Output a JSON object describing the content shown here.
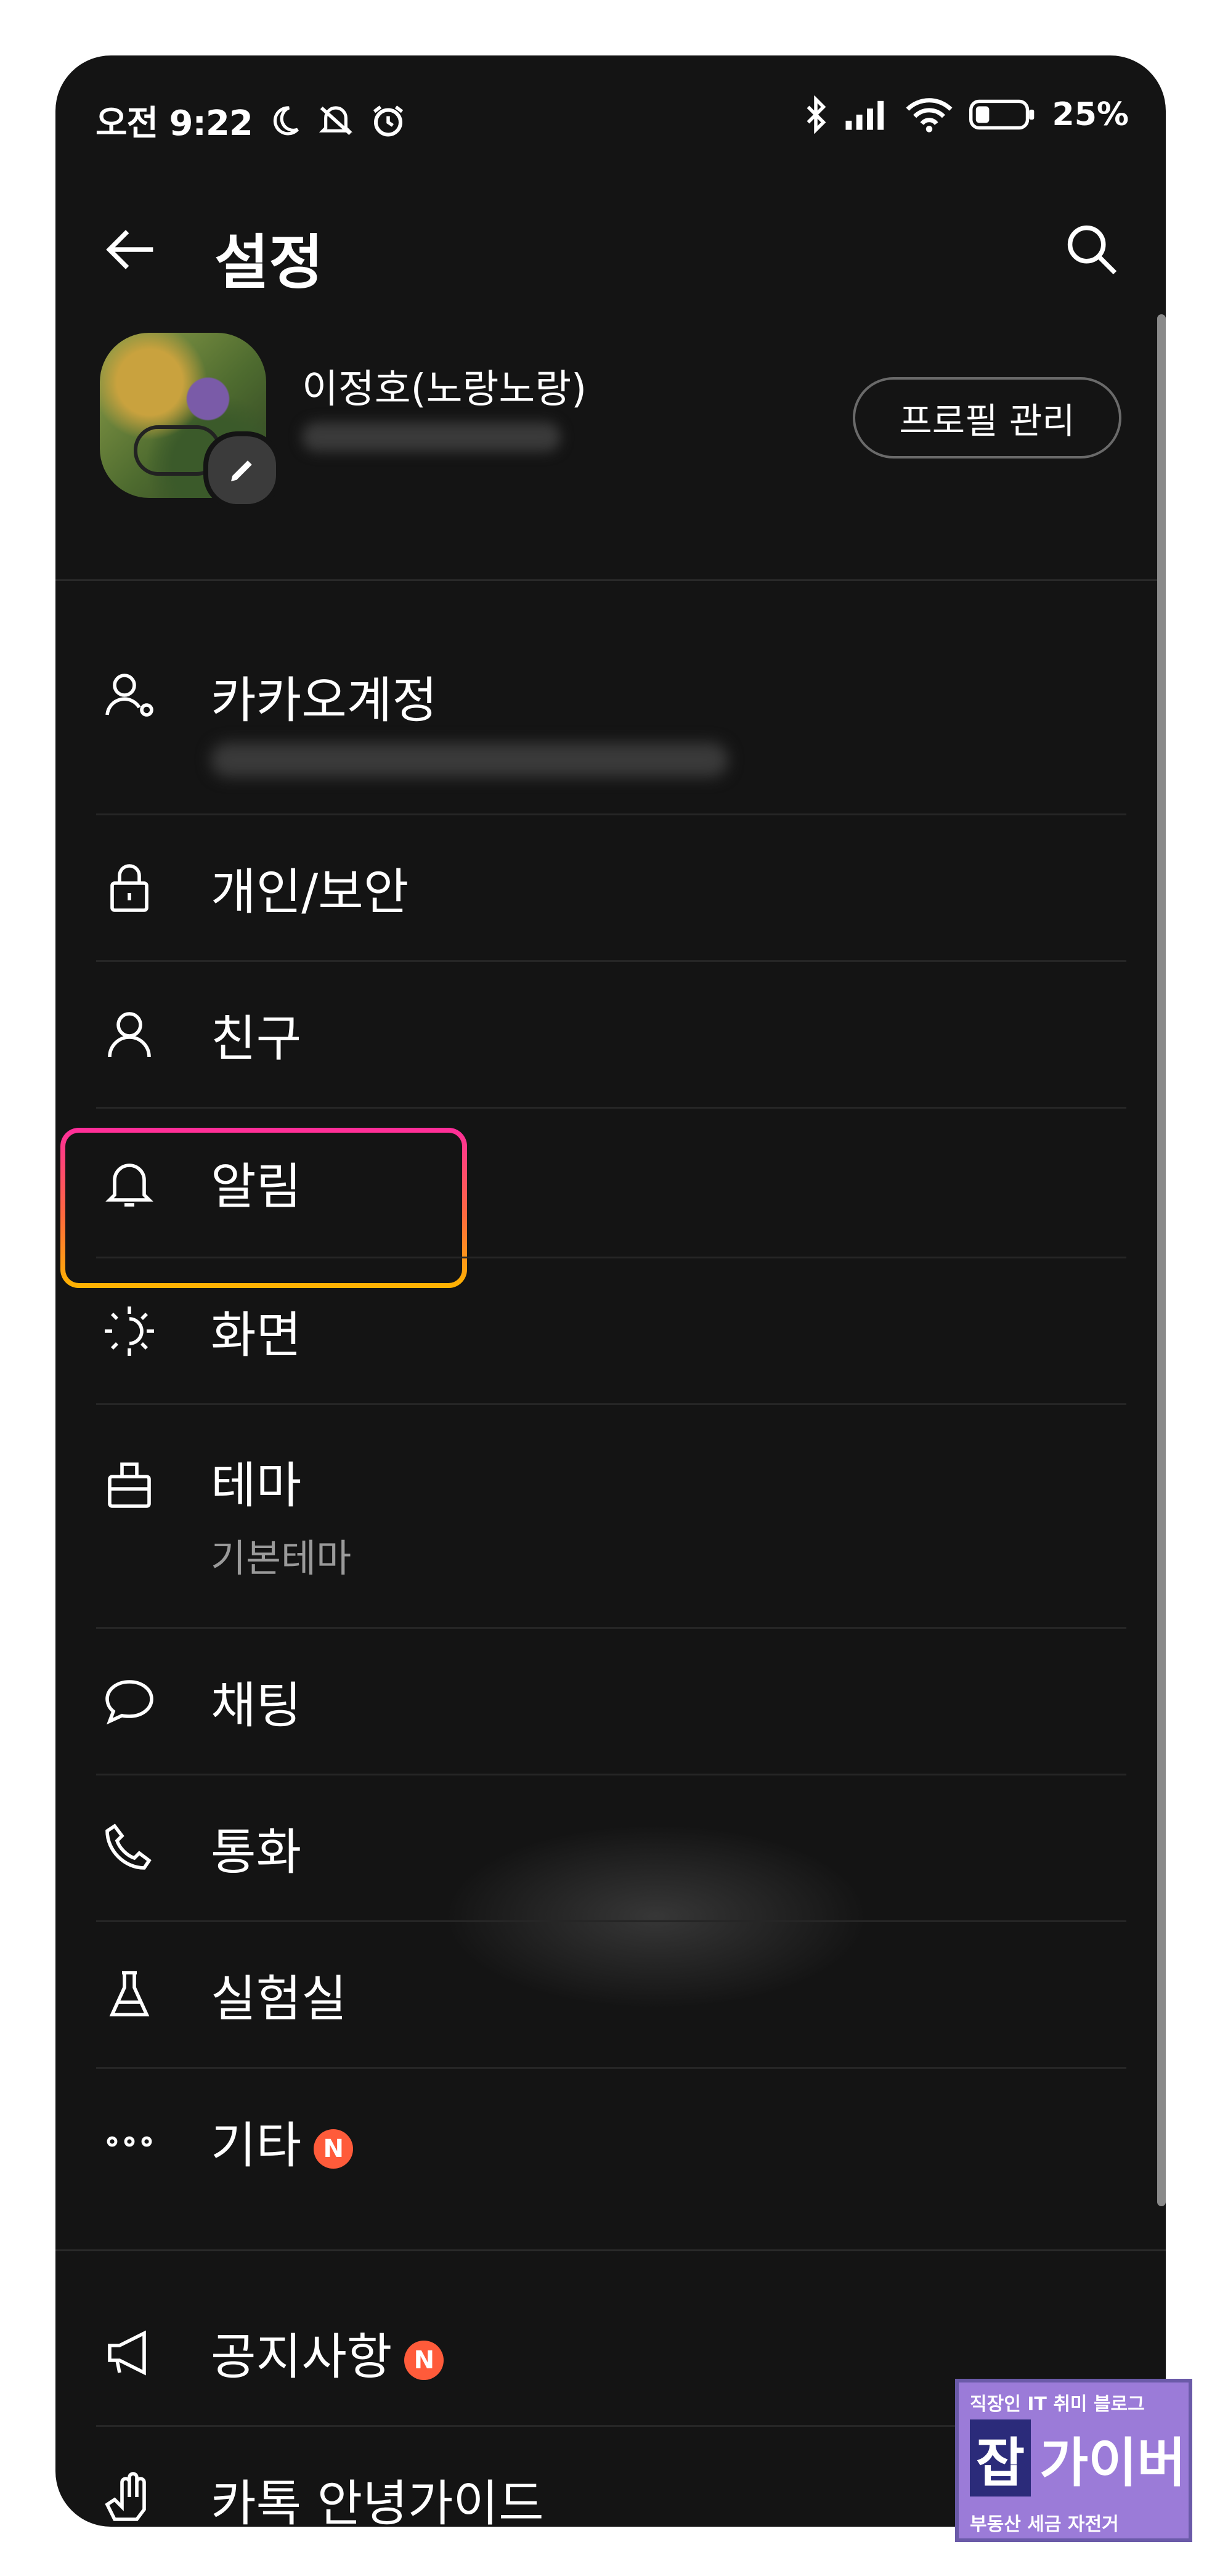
{
  "status_bar": {
    "time": "오전 9:22",
    "battery": "25%"
  },
  "header": {
    "title": "설정"
  },
  "profile": {
    "name": "이정호(노랑노랑)",
    "manage_button": "프로필 관리"
  },
  "menu": [
    {
      "id": "kakao-account",
      "icon": "account-icon",
      "label": "카카오계정"
    },
    {
      "id": "privacy",
      "icon": "lock-icon",
      "label": "개인/보안"
    },
    {
      "id": "friends",
      "icon": "person-icon",
      "label": "친구"
    },
    {
      "id": "notifications",
      "icon": "bell-icon",
      "label": "알림"
    },
    {
      "id": "display",
      "icon": "brightness-icon",
      "label": "화면"
    },
    {
      "id": "theme",
      "icon": "theme-icon",
      "label": "테마",
      "sub": "기본테마"
    },
    {
      "id": "chat",
      "icon": "chat-bubble-icon",
      "label": "채팅"
    },
    {
      "id": "call",
      "icon": "phone-icon",
      "label": "통화"
    },
    {
      "id": "lab",
      "icon": "flask-icon",
      "label": "실험실"
    },
    {
      "id": "etc",
      "icon": "more-icon",
      "label": "기타",
      "badge": "N"
    }
  ],
  "menu_secondary": [
    {
      "id": "notice",
      "icon": "megaphone-icon",
      "label": "공지사항",
      "badge": "N"
    },
    {
      "id": "kakaotalk-guide",
      "icon": "hand-icon",
      "label": "카톡 안녕가이드"
    }
  ],
  "watermark": {
    "top": "직장인 IT 취미 블로그",
    "main_left": "잡",
    "main_right": "가이버",
    "bottom": "부동산 세금 자전거"
  },
  "colors": {
    "background": "#141414",
    "highlight_top": "#ff2d9b",
    "highlight_bottom": "#ffb400",
    "badge": "#ff5b3a"
  }
}
